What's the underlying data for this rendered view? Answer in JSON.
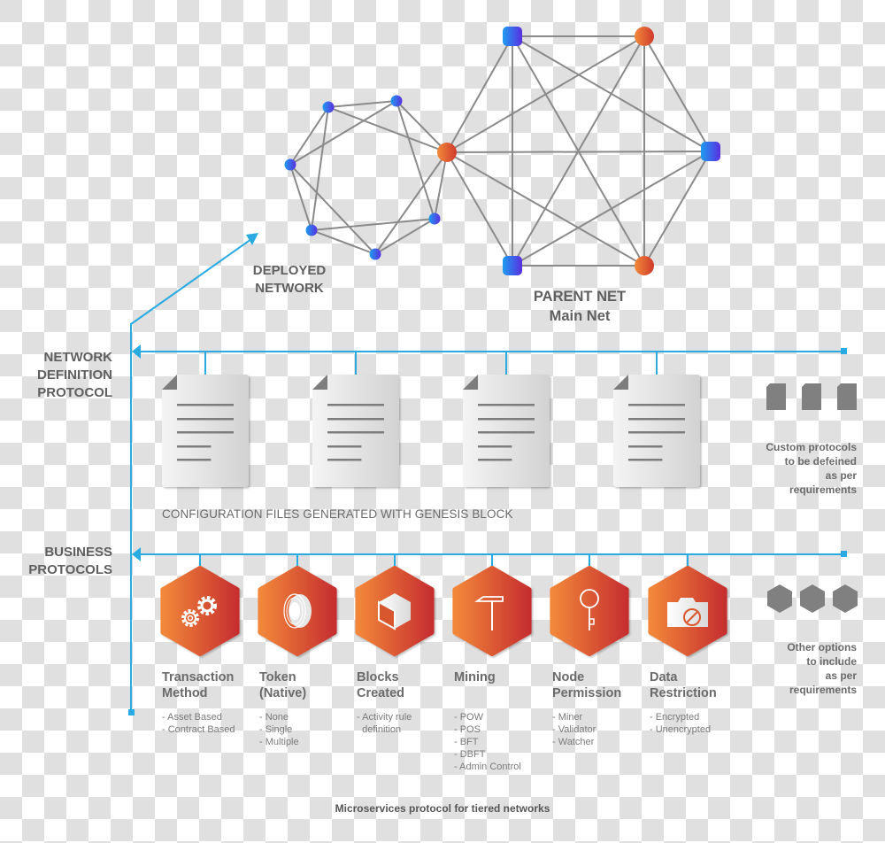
{
  "colors": {
    "accent_blue": "#29abe2",
    "edge_gray": "#8a8a8a",
    "node_blue_start": "#2196f3",
    "node_blue_end": "#5b2be0",
    "node_orange_start": "#f0843a",
    "node_orange_end": "#cc3a2e",
    "hex_orange_start": "#f0843a",
    "hex_orange_end": "#c8302f",
    "placeholder_gray": "#808080"
  },
  "networks": {
    "deployed": {
      "label_line1": "DEPLOYED",
      "label_line2": "NETWORK",
      "node_count": 8,
      "node_shape": "circle"
    },
    "parent": {
      "label_line1": "PARENT NET",
      "label_line2": "Main Net",
      "node_count": 6,
      "node_shapes": [
        "circle-orange",
        "rounded-square-blue"
      ],
      "topology": "fully-connected"
    }
  },
  "tiers": {
    "network_definition": {
      "label": [
        "NETWORK",
        "DEFINITION",
        "PROTOCOL"
      ],
      "files_count": 4,
      "file_icon": "document-icon",
      "caption": "CONFIGURATION FILES GENERATED WITH GENESIS BLOCK",
      "extra_icon": "placeholder-file-icon",
      "extra_note": [
        "Custom protocols",
        "to be defeined",
        "as per",
        "requirements"
      ]
    },
    "business": {
      "label": [
        "BUSINESS",
        "PROTOCOLS"
      ],
      "extra_icon": "placeholder-hexagon-icon",
      "extra_note": [
        "Other options",
        "to include",
        "as per",
        "requirements"
      ],
      "protocols": [
        {
          "icon": "gears-icon",
          "title": [
            "Transaction",
            "Method"
          ],
          "options": [
            "- Asset Based",
            "- Contract Based"
          ]
        },
        {
          "icon": "token-coin-icon",
          "title": [
            "Token",
            "(Native)"
          ],
          "options": [
            "- None",
            "- Single",
            "- Multiple"
          ]
        },
        {
          "icon": "cube-icon",
          "title": [
            "Blocks",
            "Created"
          ],
          "options": [
            "- Activity rule",
            "  definition"
          ]
        },
        {
          "icon": "pickaxe-hammer-icon",
          "title": [
            "Mining",
            ""
          ],
          "options": [
            "- POW",
            "- POS",
            "- BFT",
            "- DBFT",
            "- Admin Control"
          ]
        },
        {
          "icon": "key-icon",
          "title": [
            "Node",
            "Permission"
          ],
          "options": [
            "- Miner",
            "- Validator",
            "- Watcher"
          ]
        },
        {
          "icon": "folder-restricted-icon",
          "title": [
            "Data",
            "Restriction"
          ],
          "options": [
            "- Encrypted",
            "- Unencrypted"
          ]
        }
      ]
    }
  },
  "footer": "Microservices protocol for tiered networks"
}
